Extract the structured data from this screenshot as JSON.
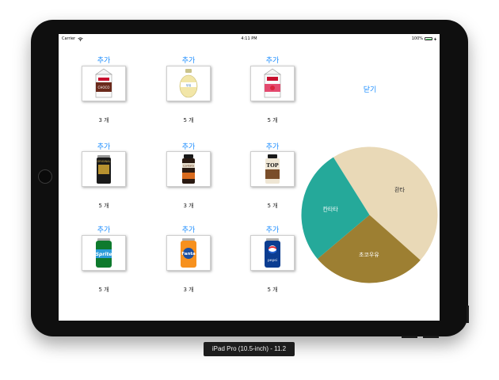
{
  "statusbar": {
    "carrier": "Carrier",
    "time": "4:11 PM",
    "battery": "100%",
    "battery_level": 1.0
  },
  "products": [
    {
      "add_label": "추가",
      "icon": "chocolate-milk-carton-icon",
      "quantity": "3 개"
    },
    {
      "add_label": "추가",
      "icon": "banana-milk-bottle-icon",
      "quantity": "5 개"
    },
    {
      "add_label": "추가",
      "icon": "strawberry-milk-carton-icon",
      "quantity": "5 개"
    },
    {
      "add_label": "추가",
      "icon": "original-coffee-can-icon",
      "quantity": "5 개"
    },
    {
      "add_label": "추가",
      "icon": "cantata-coffee-can-icon",
      "quantity": "3 개"
    },
    {
      "add_label": "추가",
      "icon": "top-coffee-can-icon",
      "quantity": "5 개"
    },
    {
      "add_label": "추가",
      "icon": "sprite-can-icon",
      "quantity": "5 개"
    },
    {
      "add_label": "추가",
      "icon": "fanta-can-icon",
      "quantity": "3 개"
    },
    {
      "add_label": "추가",
      "icon": "pepsi-can-icon",
      "quantity": "5 개"
    }
  ],
  "close_label": "닫기",
  "chart_data": {
    "type": "pie",
    "slices": [
      {
        "label": "환타",
        "value": 5,
        "color": "#e9d9b7"
      },
      {
        "label": "초코우유",
        "value": 3,
        "color": "#9d7f32"
      },
      {
        "label": "칸타타",
        "value": 3,
        "color": "#25a99a"
      }
    ]
  },
  "simulator_label": "iPad Pro (10.5-inch) - 11.2"
}
